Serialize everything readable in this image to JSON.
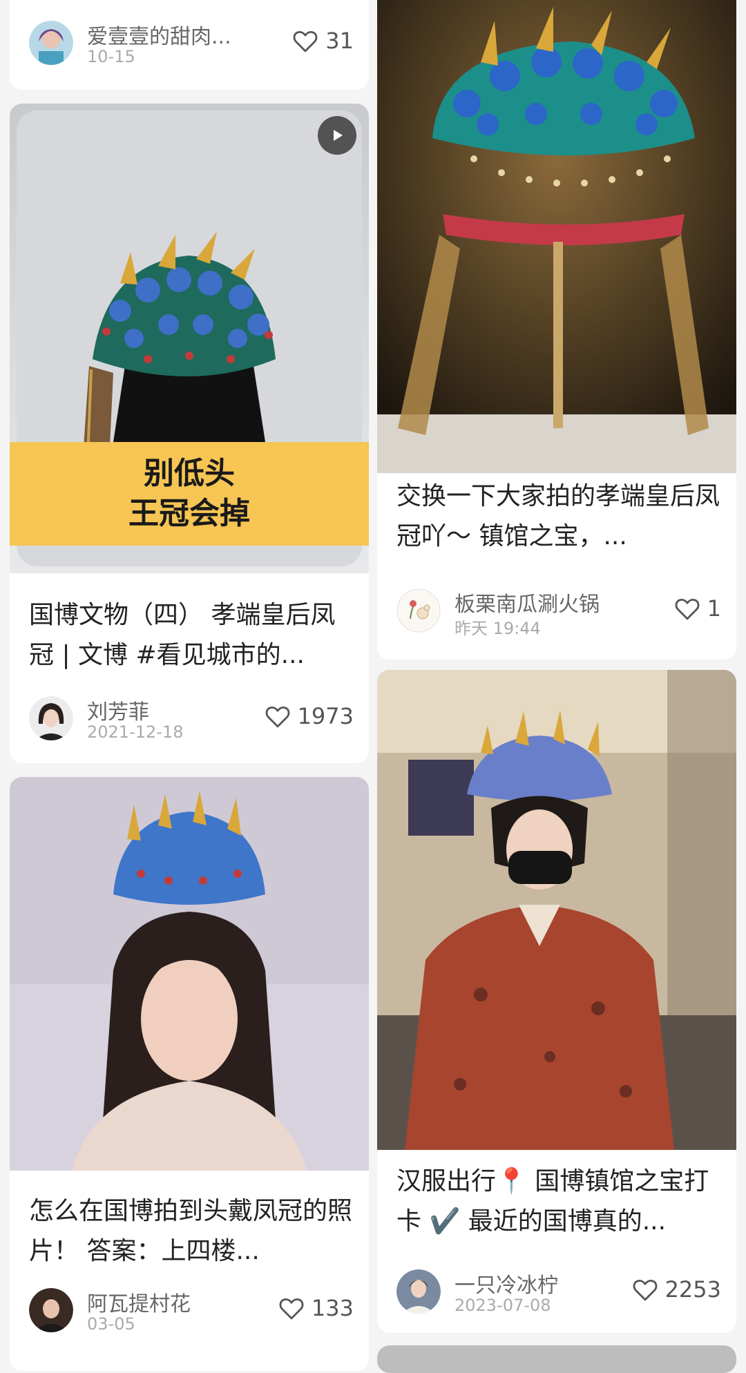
{
  "cards": [
    {
      "title": "",
      "author": "爱壹壹的甜肉...",
      "date": "10-15",
      "likes": "31",
      "image_icon": "none"
    },
    {
      "title": "国博文物（四） 孝端皇后凤冠 | 文博 #看见城市的...",
      "author": "刘芳菲",
      "date": "2021-12-18",
      "likes": "1973",
      "image_icon": "play-icon",
      "banner_line1": "别低头",
      "banner_line2": "王冠会掉"
    },
    {
      "title": "怎么在国博拍到头戴凤冠的照片！ 答案：上四楼...",
      "author": "阿瓦提村花",
      "date": "03-05",
      "likes": "133"
    },
    {
      "title": "交换一下大家拍的孝端皇后凤冠吖～ 镇馆之宝，...",
      "author": "板栗南瓜涮火锅",
      "date": "昨天 19:44",
      "likes": "1"
    },
    {
      "title": "汉服出行📍 国博镇馆之宝打卡 ✔️ 最近的国博真的...",
      "author": "一只冷冰柠",
      "date": "2023-07-08",
      "likes": "2253"
    }
  ],
  "colors": {
    "background": "#f4f4f4",
    "card": "#ffffff",
    "banner": "#f6c553"
  },
  "icons": [
    "heart-outline-icon",
    "play-icon"
  ]
}
